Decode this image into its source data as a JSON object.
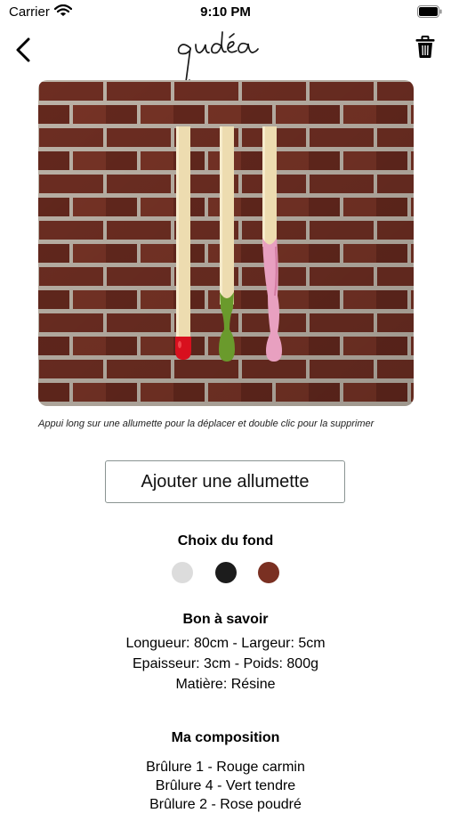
{
  "status_bar": {
    "carrier": "Carrier",
    "time": "9:10 PM"
  },
  "nav": {
    "logo_text": "gudéa",
    "back_icon": "chevron-left-icon",
    "delete_icon": "trash-icon"
  },
  "hero": {
    "background": "brick-wall",
    "matches": [
      {
        "tip_color": "#d8101e",
        "tip_style": "drop"
      },
      {
        "tip_color": "#6a9a2c",
        "tip_style": "drip"
      },
      {
        "tip_color": "#e8a0c0",
        "tip_style": "drip"
      }
    ]
  },
  "hint": "Appui long sur une allumette pour la déplacer et double clic pour la supprimer",
  "add_button": "Ajouter une allumette",
  "background_choice": {
    "title": "Choix du fond",
    "options": [
      {
        "name": "light-gray",
        "color": "#dcdcdc"
      },
      {
        "name": "black",
        "color": "#1c1c1c"
      },
      {
        "name": "brick",
        "color": "#7a3022"
      }
    ]
  },
  "info": {
    "title": "Bon à savoir",
    "lines": [
      "Longueur: 80cm - Largeur: 5cm",
      "Epaisseur: 3cm - Poids: 800g",
      "Matière: Résine"
    ]
  },
  "composition": {
    "title": "Ma composition",
    "lines": [
      "Brûlure 1 - Rouge carmin",
      "Brûlure 4 - Vert tendre",
      "Brûlure 2 - Rose poudré"
    ]
  }
}
